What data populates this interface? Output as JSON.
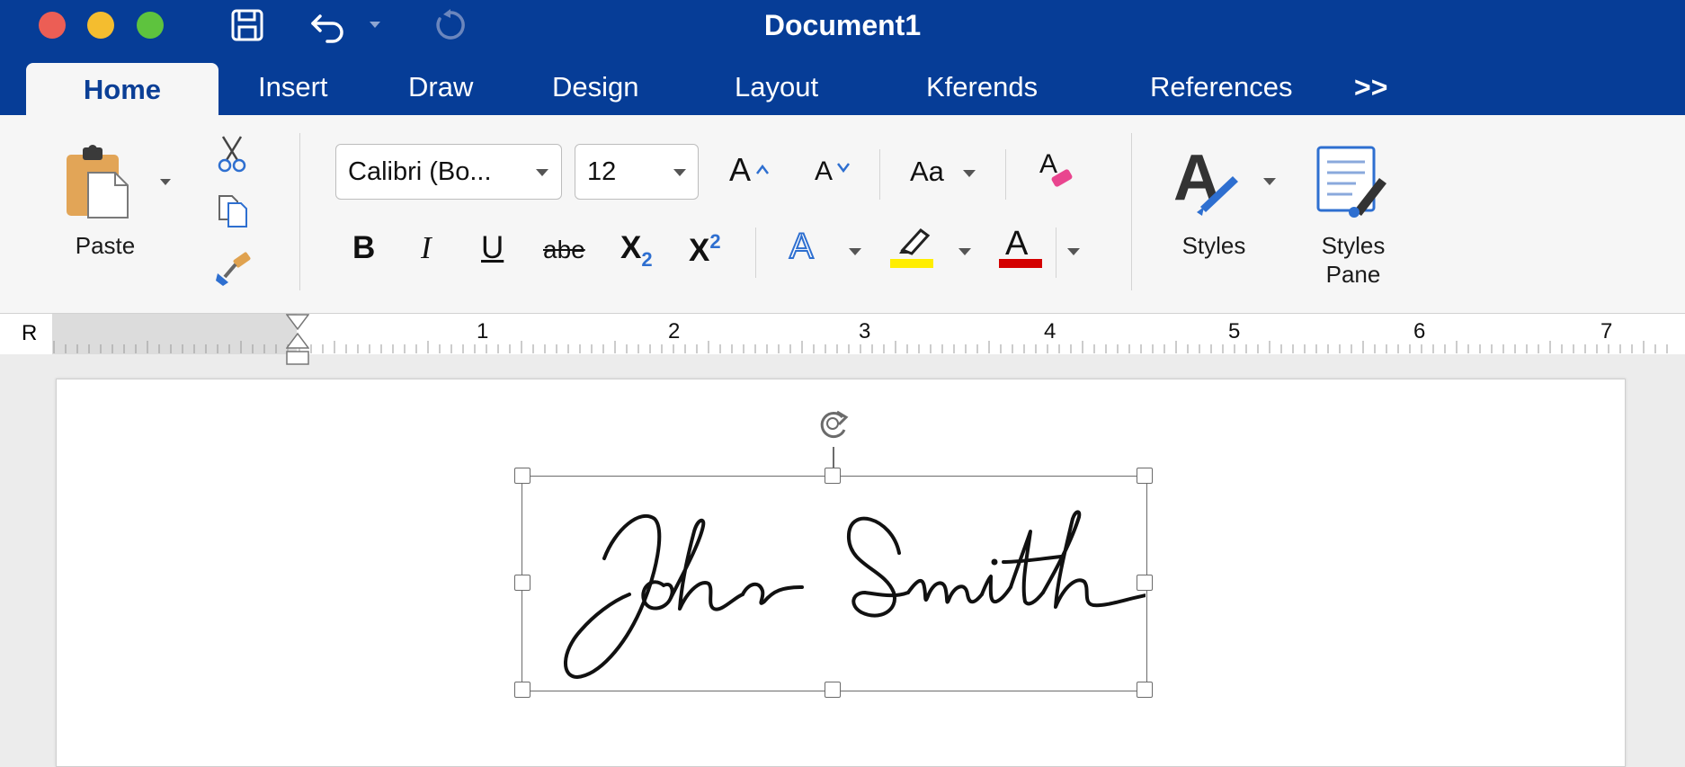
{
  "window": {
    "title": "Document1",
    "traffic_lights": [
      {
        "name": "close",
        "color": "#ec5e55"
      },
      {
        "name": "minimize",
        "color": "#f4bd2f"
      },
      {
        "name": "zoom",
        "color": "#5ec33e"
      }
    ],
    "toolbar_icons": [
      "save-icon",
      "undo-icon",
      "undo-dropdown-icon",
      "redo-icon"
    ]
  },
  "tabs": [
    {
      "label": "Home",
      "active": true
    },
    {
      "label": "Insert"
    },
    {
      "label": "Draw"
    },
    {
      "label": "Design"
    },
    {
      "label": "Layout"
    },
    {
      "label": "Kferends"
    },
    {
      "label": "References"
    },
    {
      "label": ">>"
    }
  ],
  "ribbon": {
    "clipboard": {
      "paste_label": "Paste",
      "icons": [
        "paste-icon",
        "cut-icon",
        "copy-icon",
        "format-painter-icon"
      ]
    },
    "font": {
      "name_value": "Calibri (Bo...",
      "size_value": "12",
      "grow_glyph": "A",
      "shrink_glyph": "A",
      "case_label": "Aa",
      "clear_glyph": "A",
      "bold": "B",
      "italic": "I",
      "underline": "U",
      "strike": "abe",
      "subscript_base": "X",
      "subscript_mark": "2",
      "superscript_base": "X",
      "superscript_mark": "2",
      "text_effects_glyph": "A",
      "font_color_glyph": "A",
      "highlight_color": "#ffee00",
      "font_color": "#d40000"
    },
    "styles": {
      "styles_label": "Styles",
      "pane_line1": "Styles",
      "pane_line2": "Pane"
    }
  },
  "ruler": {
    "corner": "R",
    "marks": [
      "1",
      "2",
      "3",
      "4",
      "5",
      "6",
      "7"
    ]
  },
  "document": {
    "signature_text": "John Smith"
  },
  "colors": {
    "titlebar": "#063d97",
    "accent_blue": "#2e6fd0"
  }
}
